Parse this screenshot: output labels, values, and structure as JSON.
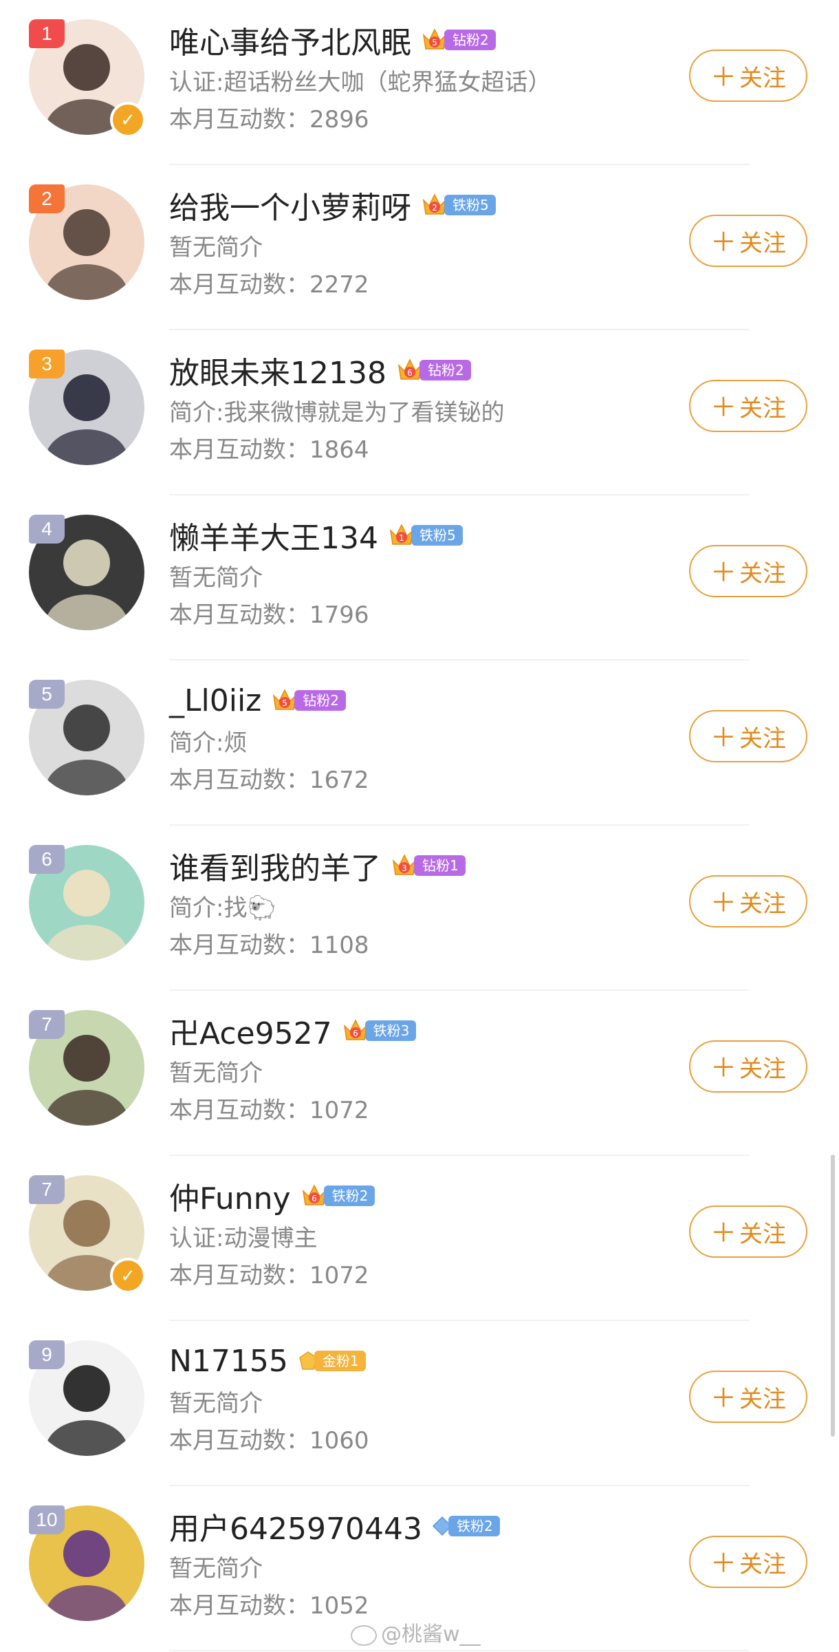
{
  "follow_label": "关注",
  "watermark": "@桃酱w__",
  "users": [
    {
      "rank": "1",
      "rank_color": "#f24b4b",
      "name": "唯心事给予北风眠",
      "crown_level": "5",
      "fan_badge": "钻粉2",
      "badge_type": "diamond",
      "description": "认证:超话粉丝大咖（蛇界猛女超话）",
      "interaction": "本月互动数：2896",
      "verified": true
    },
    {
      "rank": "2",
      "rank_color": "#f57438",
      "name": "给我一个小萝莉呀",
      "crown_level": "2",
      "fan_badge": "铁粉5",
      "badge_type": "iron",
      "description": "暂无简介",
      "interaction": "本月互动数：2272",
      "verified": false
    },
    {
      "rank": "3",
      "rank_color": "#f7a12a",
      "name": "放眼未来12138",
      "crown_level": "6",
      "fan_badge": "钻粉2",
      "badge_type": "diamond",
      "description": "简介:我来微博就是为了看镁铋的",
      "interaction": "本月互动数：1864",
      "verified": false
    },
    {
      "rank": "4",
      "rank_color": "#a7a9c8",
      "name": "懒羊羊大王134",
      "crown_level": "1",
      "fan_badge": "铁粉5",
      "badge_type": "iron",
      "description": "暂无简介",
      "interaction": "本月互动数：1796",
      "verified": false
    },
    {
      "rank": "5",
      "rank_color": "#a7a9c8",
      "name": "_Ll0iiz",
      "crown_level": "5",
      "fan_badge": "钻粉2",
      "badge_type": "diamond",
      "description": "简介:烦",
      "interaction": "本月互动数：1672",
      "verified": false
    },
    {
      "rank": "6",
      "rank_color": "#a7a9c8",
      "name": "谁看到我的羊了",
      "crown_level": "3",
      "fan_badge": "钻粉1",
      "badge_type": "diamond",
      "description": "简介:找🐑",
      "interaction": "本月互动数：1108",
      "verified": false
    },
    {
      "rank": "7",
      "rank_color": "#a7a9c8",
      "name": "卍Ace9527",
      "crown_level": "6",
      "fan_badge": "铁粉3",
      "badge_type": "iron",
      "description": "暂无简介",
      "interaction": "本月互动数：1072",
      "verified": false
    },
    {
      "rank": "7",
      "rank_color": "#a7a9c8",
      "name": "仲Funny",
      "crown_level": "6",
      "fan_badge": "铁粉2",
      "badge_type": "iron",
      "description": "认证:动漫博主",
      "interaction": "本月互动数：1072",
      "verified": true
    },
    {
      "rank": "9",
      "rank_color": "#a7a9c8",
      "name": "N17155",
      "crown_level": "",
      "fan_badge": "金粉1",
      "badge_type": "gold",
      "description": "暂无简介",
      "interaction": "本月互动数：1060",
      "verified": false
    },
    {
      "rank": "10",
      "rank_color": "#a7a9c8",
      "name": "用户6425970443",
      "crown_level": "",
      "fan_badge": "铁粉2",
      "badge_type": "iron-diamond",
      "description": "暂无简介",
      "interaction": "本月互动数：1052",
      "verified": false
    }
  ]
}
